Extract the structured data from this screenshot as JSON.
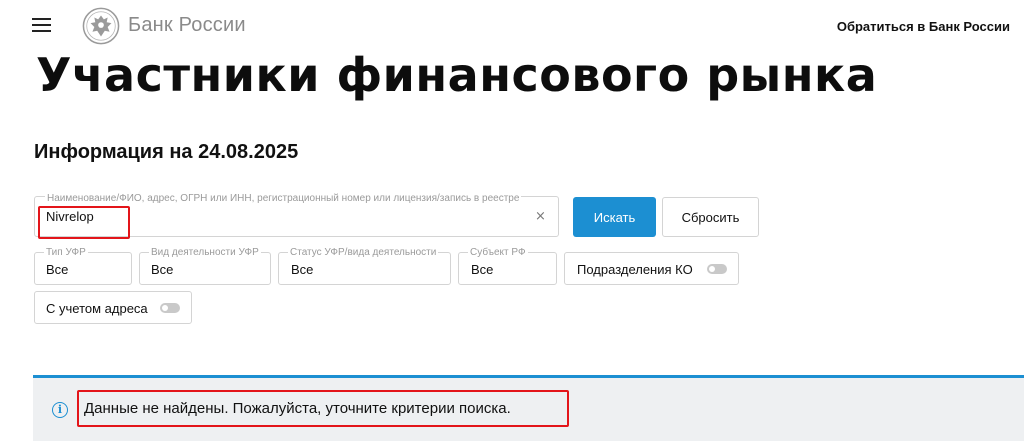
{
  "header": {
    "brand": "Банк России",
    "contact_link": "Обратиться в Банк России"
  },
  "page": {
    "title": "Участники финансового рынка",
    "info_date": "Информация на 24.08.2025"
  },
  "search": {
    "label": "Наименование/ФИО, адрес, ОГРН или ИНН, регистрационный номер или лицензия/запись в реестре",
    "value": "Nivrelop",
    "clear_glyph": "×",
    "search_button": "Искать",
    "reset_button": "Сбросить"
  },
  "filters": [
    {
      "label": "Тип УФР",
      "value": "Все"
    },
    {
      "label": "Вид деятельности УФР",
      "value": "Все"
    },
    {
      "label": "Статус УФР/вида деятельности",
      "value": "Все"
    },
    {
      "label": "Субъект РФ",
      "value": "Все"
    }
  ],
  "toggles": {
    "branches": {
      "label": "Подразделения КО",
      "enabled": false
    },
    "address": {
      "label": "С учетом адреса",
      "enabled": false
    }
  },
  "result": {
    "icon": "info-icon",
    "message": "Данные не найдены. Пожалуйста, уточните критерии поиска."
  },
  "colors": {
    "accent": "#1c8fd2",
    "highlight": "#e3151a",
    "banner_bg": "#eef0f2"
  }
}
